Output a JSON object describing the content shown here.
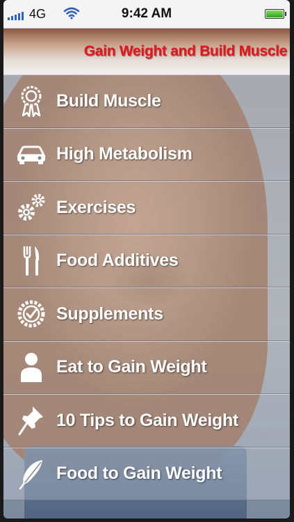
{
  "status_bar": {
    "network": "4G",
    "time": "9:42 AM"
  },
  "header": {
    "title": "Gain Weight and Build Muscle"
  },
  "menu": {
    "items": [
      {
        "label": "Build Muscle",
        "icon": "award-ribbon-icon"
      },
      {
        "label": "High Metabolism",
        "icon": "car-icon"
      },
      {
        "label": "Exercises",
        "icon": "gears-icon"
      },
      {
        "label": "Food Additives",
        "icon": "fork-knife-icon"
      },
      {
        "label": "Supplements",
        "icon": "check-badge-icon"
      },
      {
        "label": "Eat to Gain Weight",
        "icon": "person-icon"
      },
      {
        "label": "10 Tips to Gain Weight",
        "icon": "pushpin-icon"
      },
      {
        "label": "Food to Gain Weight",
        "icon": "feather-icon"
      }
    ]
  },
  "colors": {
    "title_red": "#e3161e",
    "label_white": "#ffffff",
    "status_blue": "#2d62b8",
    "battery_green": "#2fa020"
  }
}
